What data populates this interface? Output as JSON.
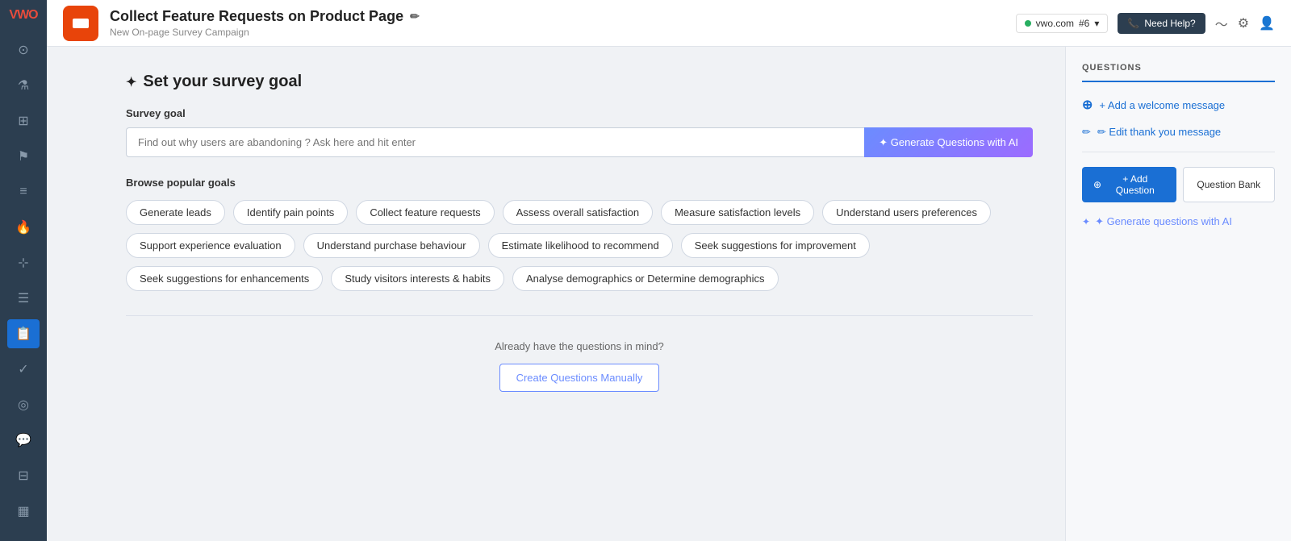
{
  "app": {
    "logo": "VWO",
    "logo_color": "#e74c3c"
  },
  "topbar": {
    "campaign_title": "Collect Feature Requests on Product Page",
    "campaign_subtitle": "New On-page Survey Campaign",
    "workspace": "vwo.com",
    "workspace_number": "#6",
    "need_help": "Need Help?"
  },
  "sidebar": {
    "items": [
      {
        "id": "dashboard",
        "icon": "⊙",
        "active": false
      },
      {
        "id": "flask",
        "icon": "⚗",
        "active": false
      },
      {
        "id": "puzzle",
        "icon": "⊞",
        "active": false
      },
      {
        "id": "flag",
        "icon": "⚑",
        "active": false
      },
      {
        "id": "layers",
        "icon": "≡",
        "active": false
      },
      {
        "id": "fire",
        "icon": "🔥",
        "active": false
      },
      {
        "id": "cursor",
        "icon": "⊹",
        "active": false
      },
      {
        "id": "list",
        "icon": "☰",
        "active": false
      },
      {
        "id": "survey",
        "icon": "📋",
        "active": true
      },
      {
        "id": "tasks",
        "icon": "✓",
        "active": false
      },
      {
        "id": "target",
        "icon": "◎",
        "active": false
      },
      {
        "id": "feedback",
        "icon": "💬",
        "active": false
      },
      {
        "id": "database",
        "icon": "⊟",
        "active": false
      },
      {
        "id": "chart",
        "icon": "▦",
        "active": false
      }
    ]
  },
  "main": {
    "section_title": "Set your survey goal",
    "survey_goal_label": "Survey goal",
    "input_placeholder": "Find out why users are abandoning ? Ask here and hit enter",
    "generate_btn_label": "✦ Generate Questions with AI",
    "browse_title": "Browse popular goals",
    "goals": [
      "Generate leads",
      "Identify pain points",
      "Collect feature requests",
      "Assess overall satisfaction",
      "Measure satisfaction levels",
      "Understand users preferences",
      "Support experience evaluation",
      "Understand purchase behaviour",
      "Estimate likelihood to recommend",
      "Seek suggestions for improvement",
      "Seek suggestions for enhancements",
      "Study visitors interests & habits",
      "Analyse demographics or Determine demographics"
    ],
    "divider_text": "Already have the questions in mind?",
    "manual_btn_label": "Create Questions Manually"
  },
  "right_panel": {
    "header": "QUESTIONS",
    "add_welcome_label": "+ Add a welcome message",
    "edit_thankyou_label": "✏ Edit thank you message",
    "add_question_label": "+ Add Question",
    "question_bank_label": "Question Bank",
    "generate_ai_label": "✦ Generate questions with AI"
  }
}
